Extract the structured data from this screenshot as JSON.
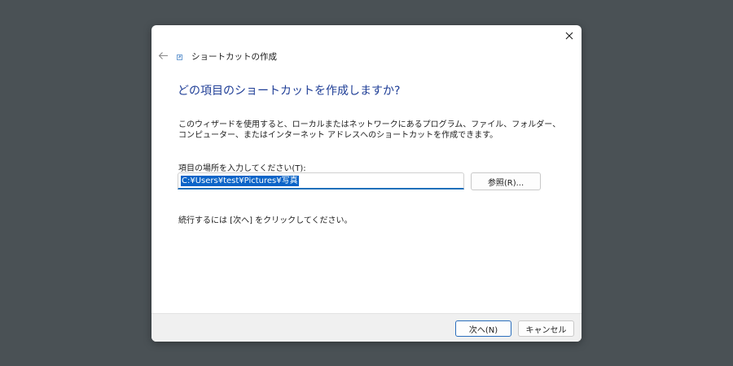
{
  "window": {
    "title": "ショートカットの作成",
    "icons": {
      "close": "close-icon",
      "back": "back-arrow-icon",
      "title": "shortcut-wizard-icon"
    }
  },
  "main": {
    "heading": "どの項目のショートカットを作成しますか?",
    "description": "このウィザードを使用すると、ローカルまたはネットワークにあるプログラム、ファイル、フォルダー、コンピューター、またはインターネット アドレスへのショートカットを作成できます。",
    "location_label": "項目の場所を入力してください(T):",
    "location_value": "C:¥Users¥test¥Pictures¥写真",
    "browse_label": "参照(R)...",
    "continue_text": "続行するには [次へ] をクリックしてください。"
  },
  "footer": {
    "next_label": "次へ(N)",
    "cancel_label": "キャンセル"
  },
  "colors": {
    "desktop": "#4a5155",
    "heading": "#1e3d96",
    "accent": "#1f6fba",
    "selection": "#0a64c8"
  }
}
